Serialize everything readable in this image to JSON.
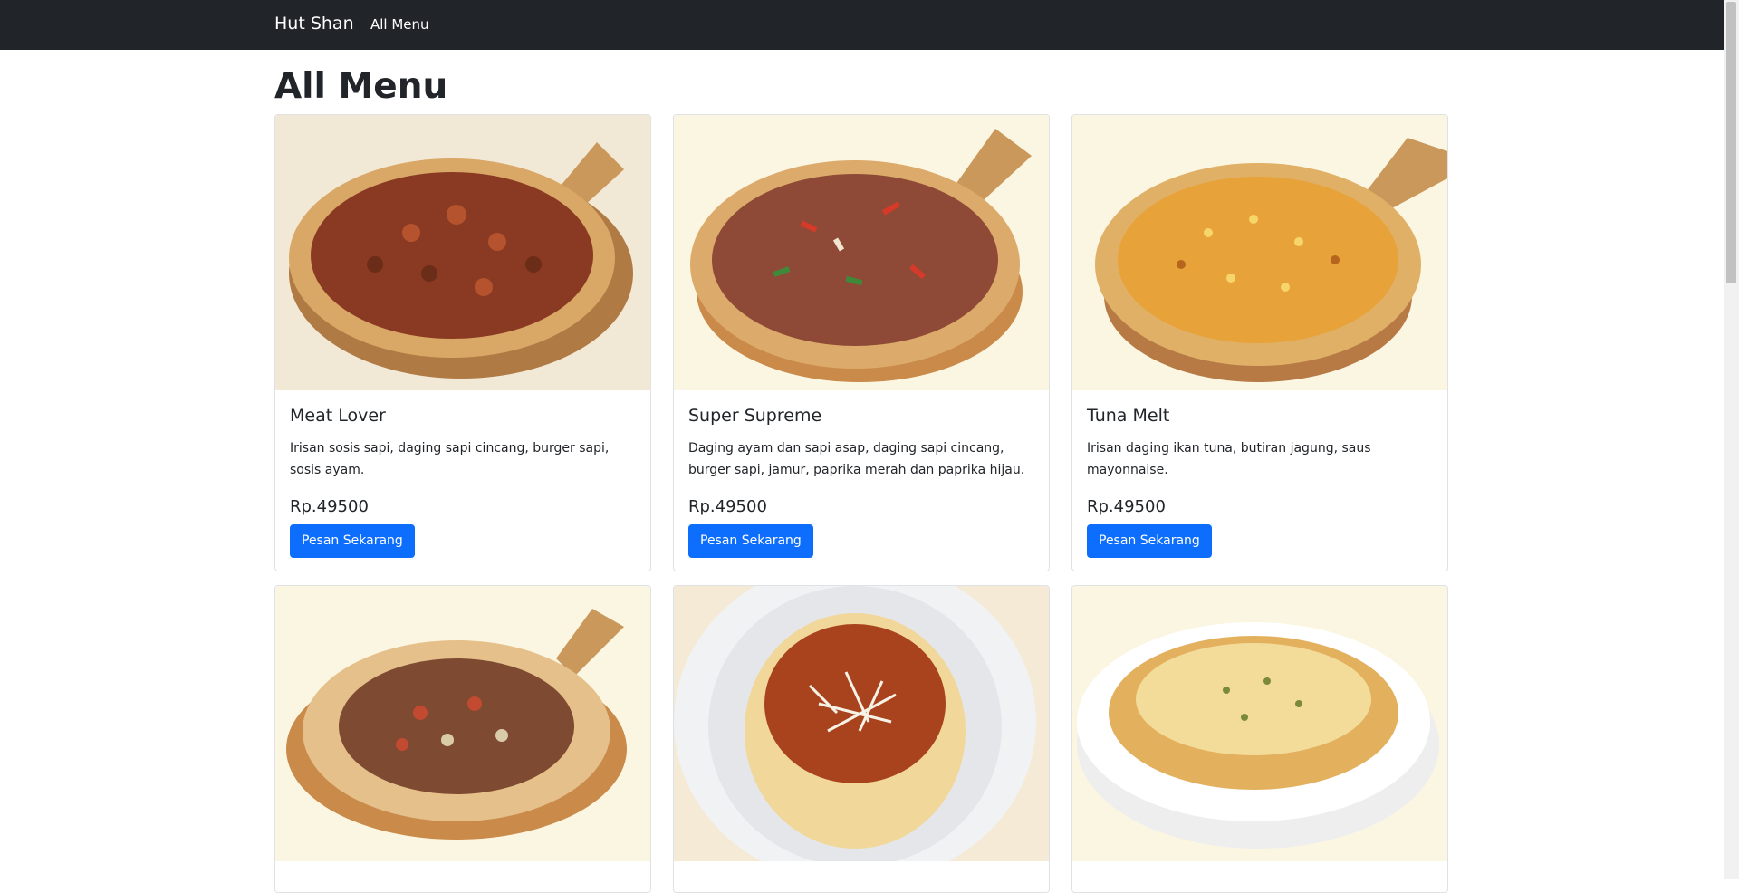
{
  "navbar": {
    "brand": "Hut Shan",
    "links": [
      "All Menu"
    ]
  },
  "page": {
    "title": "All Menu"
  },
  "menu": [
    {
      "name": "Meat Lover",
      "description": "Irisan sosis sapi, daging sapi cincang, burger sapi, sosis ayam.",
      "price": "Rp.49500",
      "button_label": "Pesan Sekarang",
      "image": "meat-lover-pizza-image"
    },
    {
      "name": "Super Supreme",
      "description": "Daging ayam dan sapi asap, daging sapi cincang, burger sapi, jamur, paprika merah dan paprika hijau.",
      "price": "Rp.49500",
      "button_label": "Pesan Sekarang",
      "image": "super-supreme-pizza-image"
    },
    {
      "name": "Tuna Melt",
      "description": "Irisan daging ikan tuna, butiran jagung, saus mayonnaise.",
      "price": "Rp.49500",
      "button_label": "Pesan Sekarang",
      "image": "tuna-melt-pizza-image"
    },
    {
      "image": "crown-crust-pizza-image"
    },
    {
      "image": "spaghetti-bolognese-image"
    },
    {
      "image": "lasagna-image"
    }
  ],
  "colors": {
    "navbar_bg": "#212529",
    "primary": "#0d6efd",
    "image_bg": "#fbf6e2"
  }
}
